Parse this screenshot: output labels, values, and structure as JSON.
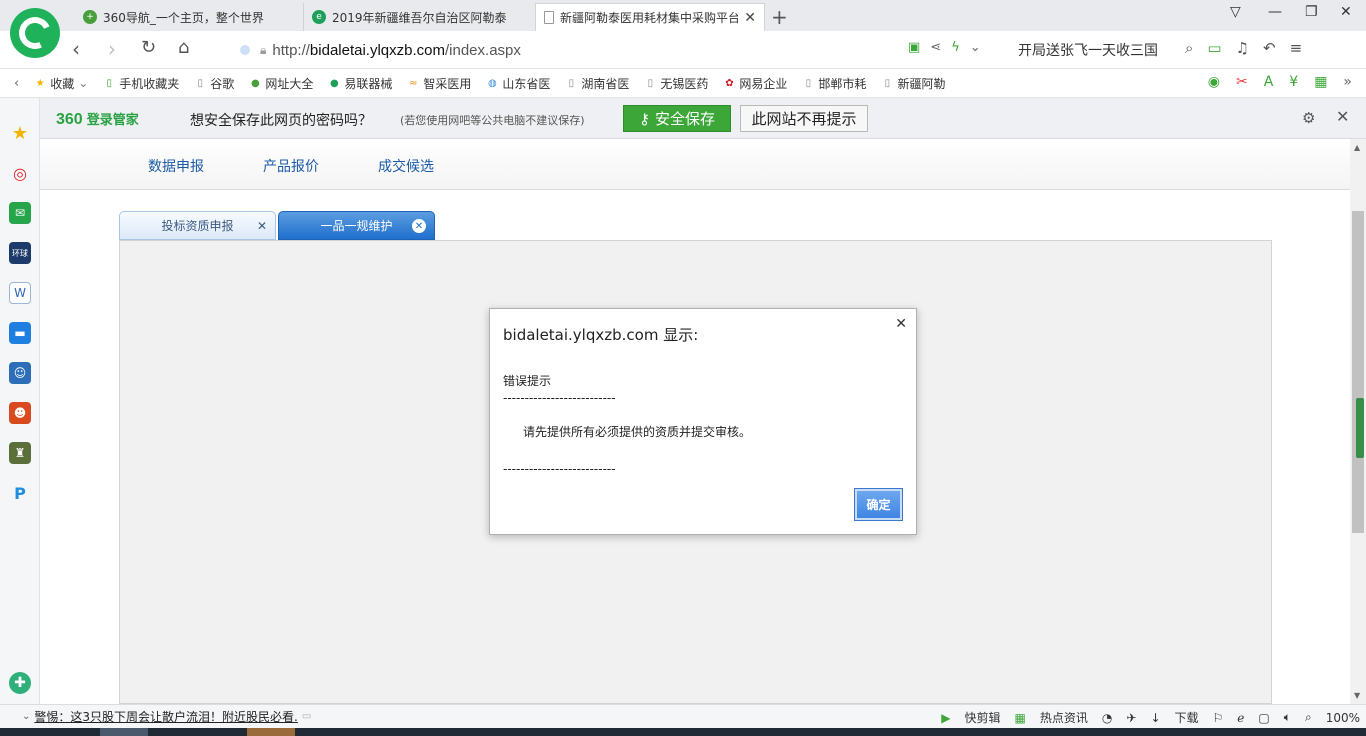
{
  "tabs": [
    {
      "label": "360导航_一个主页，整个世界",
      "icon": "360-nav-icon"
    },
    {
      "label": "2019年新疆维吾尔自治区阿勒泰",
      "icon": "browser-e-icon"
    },
    {
      "label": "新疆阿勒泰医用耗材集中采购平台",
      "icon": "document-icon",
      "active": true
    }
  ],
  "address": {
    "url_prefix": "http://",
    "url_host": "bidaletai.ylqxzb.com",
    "url_path": "/index.aspx",
    "ad_text": "开局送张飞一天收三国"
  },
  "bookmarks": [
    {
      "label": "收藏",
      "icon": "star-icon"
    },
    {
      "label": "手机收藏夹",
      "icon": "phone-icon"
    },
    {
      "label": "谷歌",
      "icon": "page-icon"
    },
    {
      "label": "网址大全",
      "icon": "360-icon"
    },
    {
      "label": "易联器械",
      "icon": "green-e-icon"
    },
    {
      "label": "智采医用",
      "icon": "wave-icon"
    },
    {
      "label": "山东省医",
      "icon": "globe-icon"
    },
    {
      "label": "湖南省医",
      "icon": "page-icon"
    },
    {
      "label": "无锡医药",
      "icon": "page-icon"
    },
    {
      "label": "网易企业",
      "icon": "netease-icon"
    },
    {
      "label": "邯郸市耗",
      "icon": "page-icon"
    },
    {
      "label": "新疆阿勒",
      "icon": "page-icon"
    }
  ],
  "password_bar": {
    "brand_num": "360",
    "brand_text": "登录管家",
    "question": "想安全保存此网页的密码吗？",
    "note": "(若您使用网吧等公共电脑不建议保存)",
    "save_label": "安全保存",
    "never_label": "此网站不再提示"
  },
  "page_nav": [
    "数据申报",
    "产品报价",
    "成交候选"
  ],
  "page_tabs": [
    {
      "label": "投标资质申报",
      "active": false
    },
    {
      "label": "一品一规维护",
      "active": true
    }
  ],
  "dialog": {
    "title": "bidaletai.ylqxzb.com 显示:",
    "heading": "错误提示",
    "separator": "--------------------------",
    "message": "请先提供所有必须提供的资质并提交审核。",
    "ok_label": "确定"
  },
  "status": {
    "warning": "警惕：这3只股下周会让散户流泪！附近股民必看.",
    "clip": "快剪辑",
    "news": "热点资讯",
    "download": "下载",
    "zoom": "100%"
  },
  "colors": {
    "accent_green": "#3ca638",
    "link_blue": "#1c5aa8",
    "tab_active": "#1f6fcd",
    "ok_button": "#3f85e4"
  }
}
